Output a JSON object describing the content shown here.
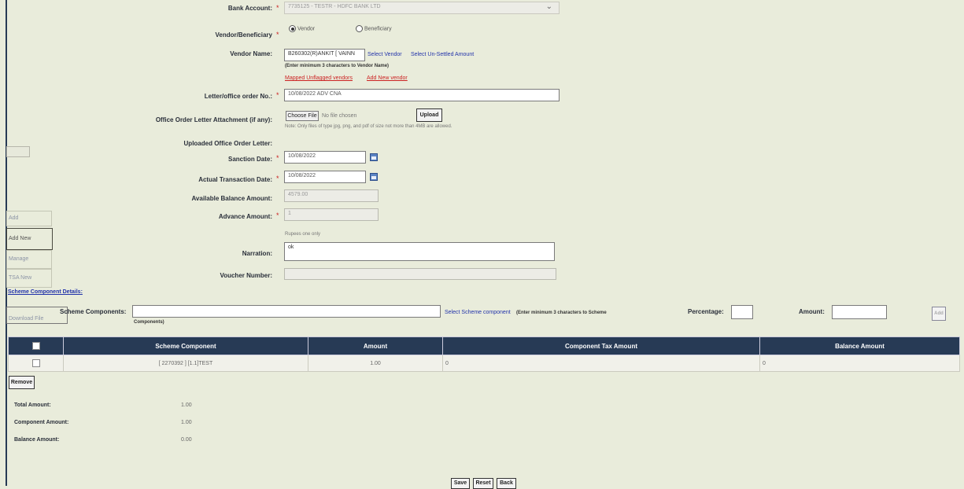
{
  "form": {
    "bank_account": {
      "label": "Bank Account:",
      "value": "7735125 - TESTR - HDFC BANK LTD"
    },
    "vendor_beneficiary": {
      "label": "Vendor/Beneficiary",
      "options": [
        "Vendor",
        "Beneficiary"
      ],
      "selected": "Vendor"
    },
    "vendor_name": {
      "label": "Vendor Name:",
      "value": "B260302(R)ANKIT  [ VAINN",
      "select_vendor": "Select Vendor",
      "select_unsettled": "Select Un-Settled Amount",
      "hint": "(Enter minimum 3 characters to Vendor Name)",
      "mapped_unflagged": "Mapped Unflagged vendors",
      "add_new_vendor": "Add New vendor"
    },
    "letter_no": {
      "label": "Letter/office order No.:",
      "value": "10/08/2022 ADV CNA"
    },
    "attachment": {
      "label": "Office Order Letter Attachment (if any):",
      "choose_file": "Choose File",
      "no_file": "No file chosen",
      "upload": "Upload",
      "note": "Note: Only files of type jpg, png, and pdf of size not more than 4MB are allowed."
    },
    "uploaded_letter": {
      "label": "Uploaded Office Order Letter:"
    },
    "sanction_date": {
      "label": "Sanction Date:",
      "value": "10/08/2022"
    },
    "actual_txn_date": {
      "label": "Actual Transaction Date:",
      "value": "10/08/2022"
    },
    "available_balance": {
      "label": "Available Balance Amount:",
      "value": "4579.00"
    },
    "advance_amount": {
      "label": "Advance Amount:",
      "value": "1",
      "words": "Rupees one only"
    },
    "narration": {
      "label": "Narration:",
      "value": "ok"
    },
    "voucher_number": {
      "label": "Voucher Number:",
      "value": ""
    }
  },
  "sidebar": {
    "items": [
      "Add",
      "Add New",
      "Manage",
      "TSA New",
      "Download File"
    ]
  },
  "scheme": {
    "section_title": "Scheme Component Details:",
    "components_label": "Scheme Components:",
    "select_link": "Select Scheme component",
    "hint_a": "(Enter minimum 3 characters to Scheme",
    "hint_b": "Components)",
    "percentage_label": "Percentage:",
    "amount_label": "Amount:",
    "add_button": "Add"
  },
  "table": {
    "headers": [
      "Scheme Component",
      "Amount",
      "Component Tax Amount",
      "Balance Amount"
    ],
    "rows": [
      {
        "component": "[ 2270392 ] [1.1]TEST",
        "amount": "1.00",
        "tax": "0",
        "balance": "0"
      }
    ]
  },
  "remove_button": "Remove",
  "totals": {
    "total_label": "Total Amount:",
    "total_value": "1.00",
    "component_label": "Component Amount:",
    "component_value": "1.00",
    "balance_label": "Balance Amount:",
    "balance_value": "0.00"
  },
  "actions": {
    "save": "Save",
    "reset": "Reset",
    "back": "Back"
  }
}
